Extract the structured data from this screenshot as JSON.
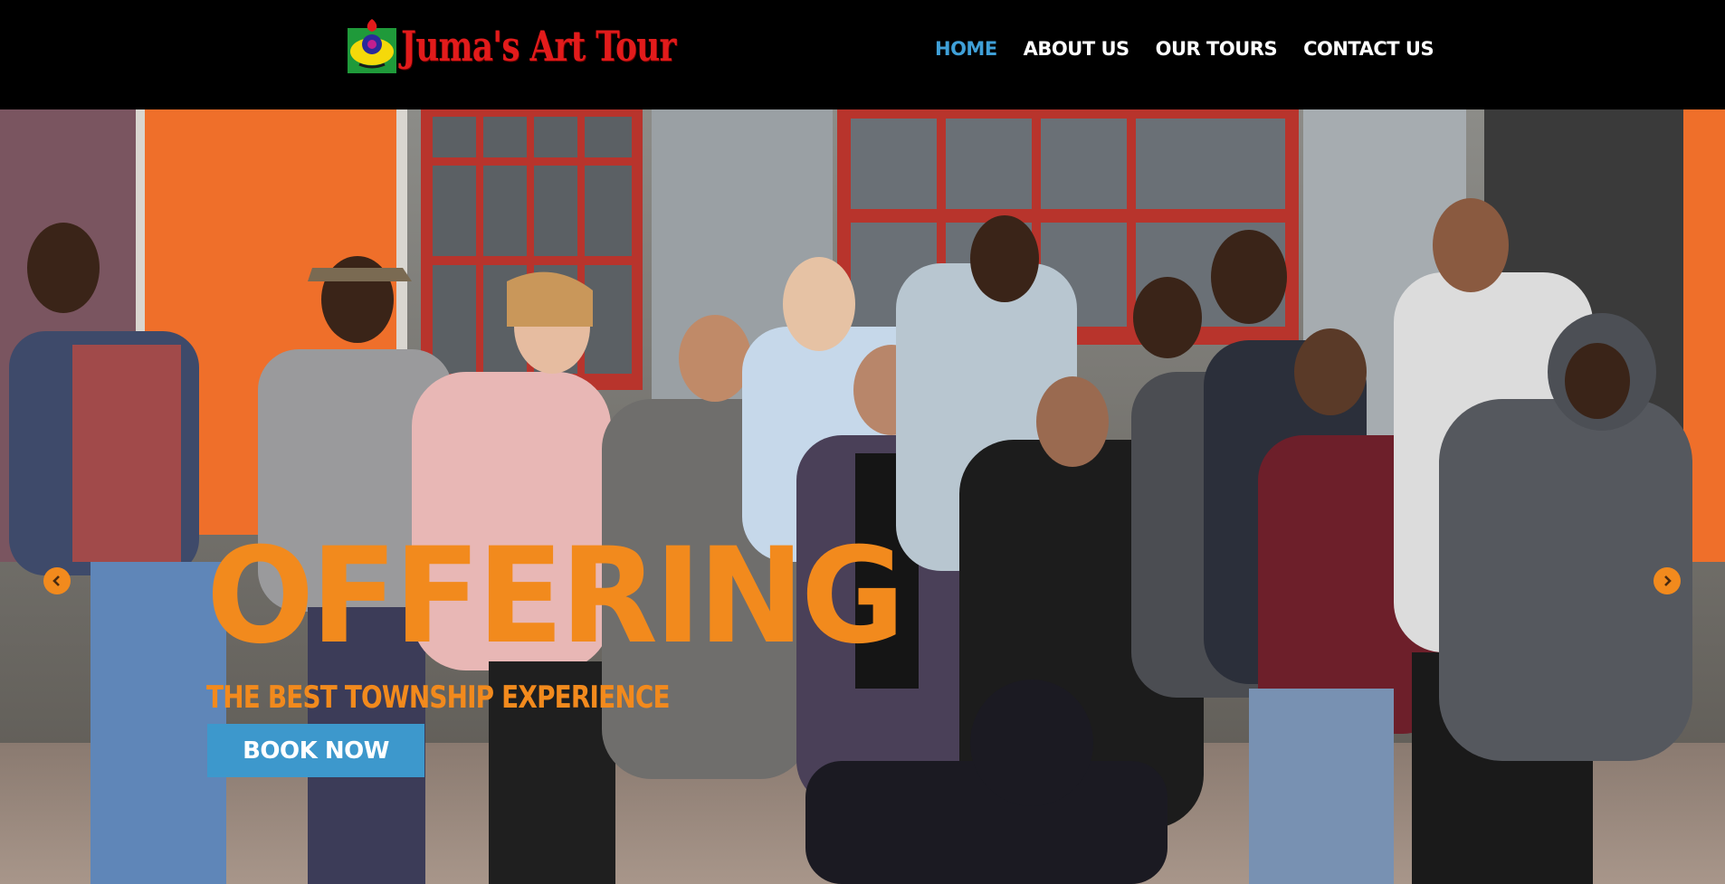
{
  "brand": {
    "name": "Juma's Art Tour",
    "logo_icon": "art-palette-logo-icon"
  },
  "nav": {
    "items": [
      {
        "label": "HOME",
        "active": true
      },
      {
        "label": "ABOUT US",
        "active": false
      },
      {
        "label": "OUR TOURS",
        "active": false
      },
      {
        "label": "CONTACT US",
        "active": false
      }
    ]
  },
  "hero": {
    "title": "OFFERING",
    "subtitle": "THE BEST TOWNSHIP EXPERIENCE",
    "cta_label": "BOOK NOW",
    "prev_icon": "chevron-left-icon",
    "next_icon": "chevron-right-icon"
  },
  "colors": {
    "nav_active": "#3fa0d8",
    "accent_orange": "#f28a1d",
    "button_blue": "#3d98cc",
    "header_bg": "#000000",
    "logo_red": "#e21b1b"
  }
}
